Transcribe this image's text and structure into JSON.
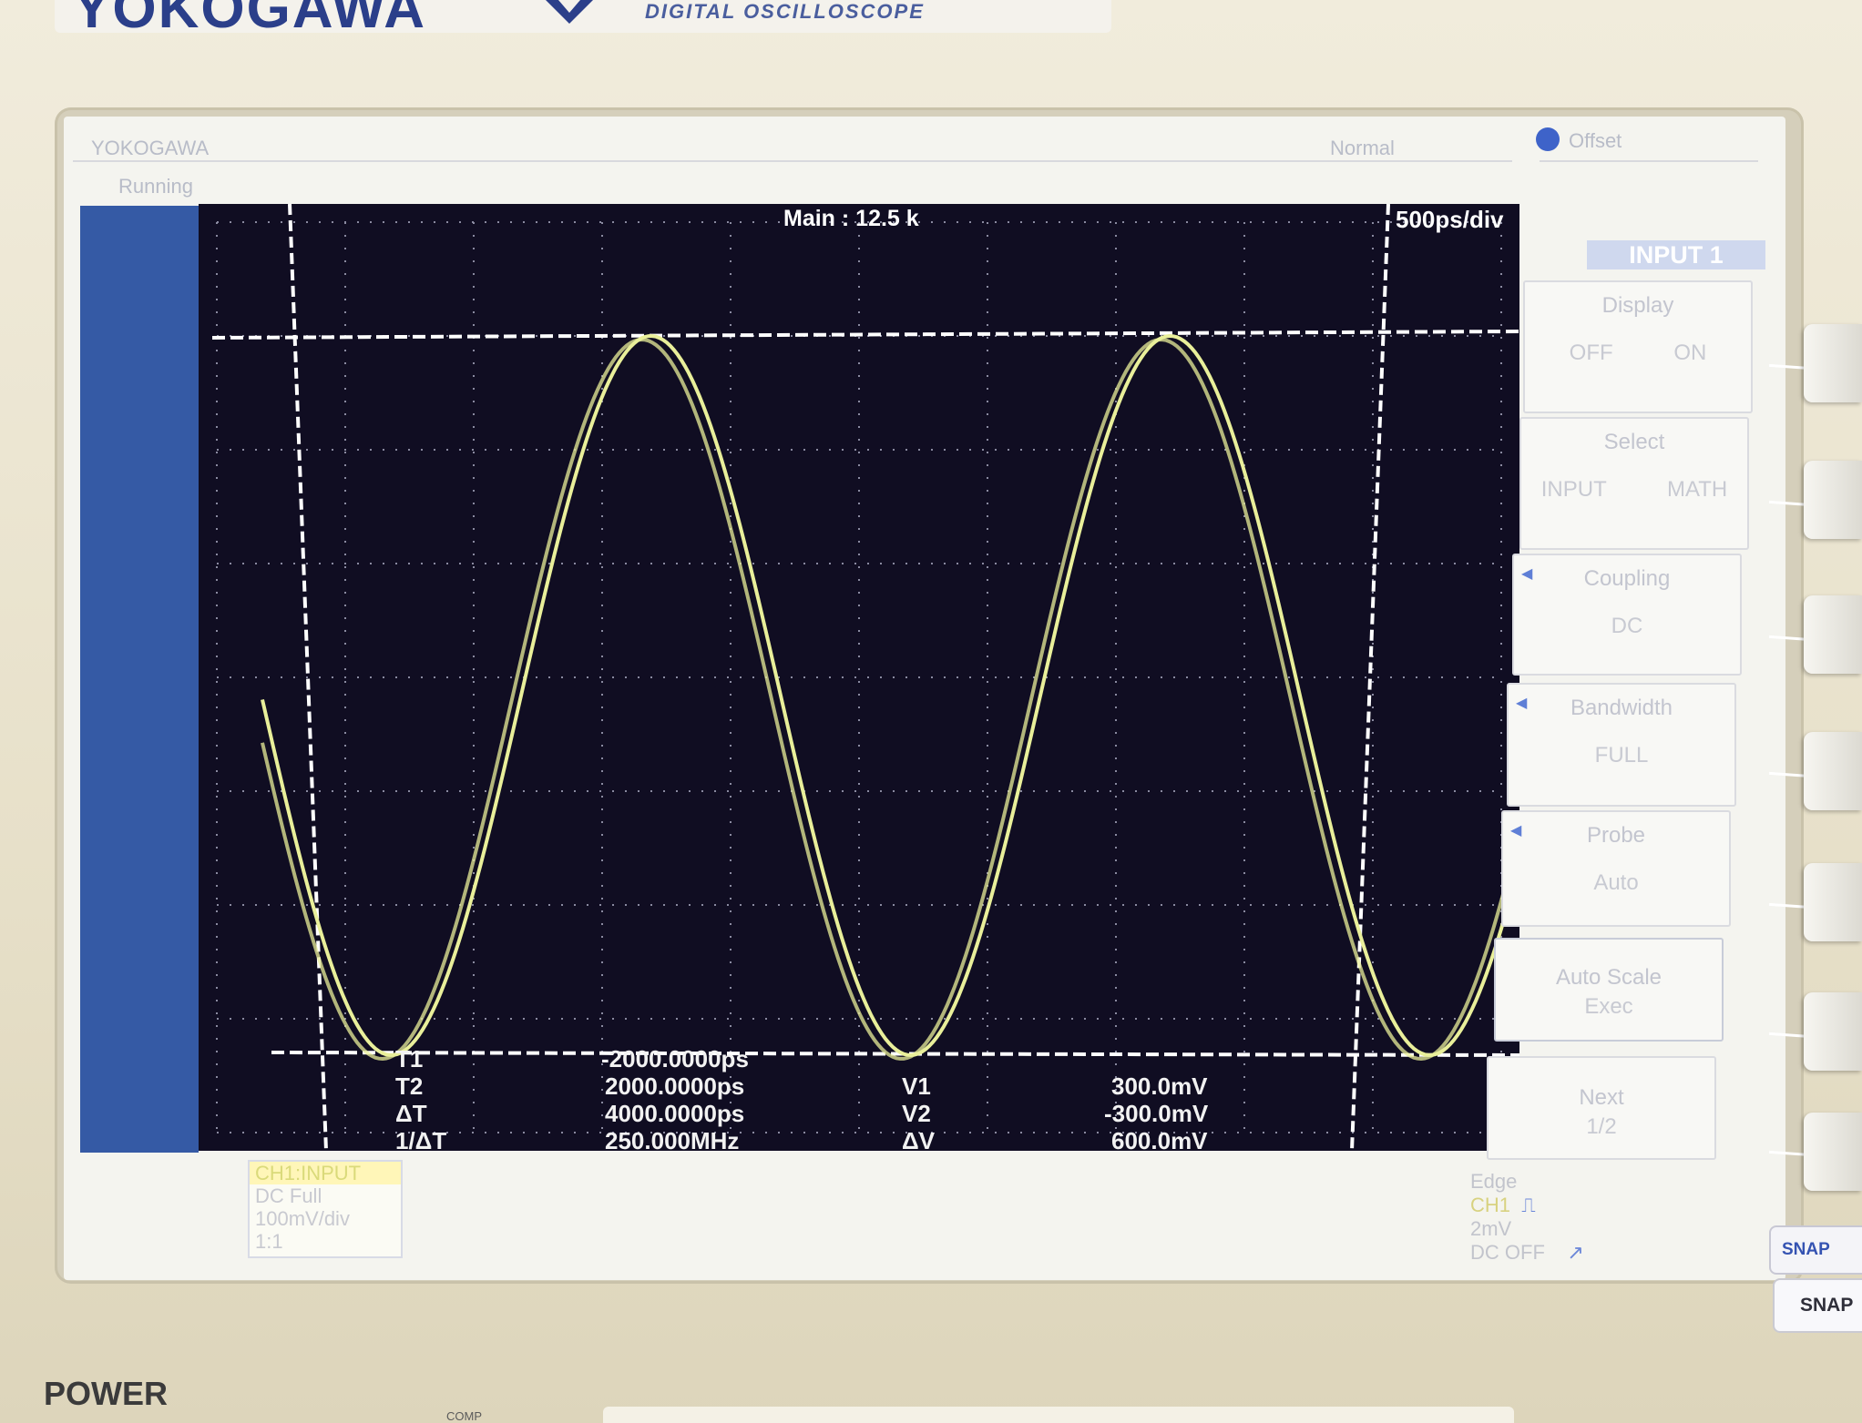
{
  "instrument": {
    "brand": "YOKOGAWA",
    "model_line": "DIGITAL OSCILLOSCOPE"
  },
  "header": {
    "left_brand": "YOKOGAWA",
    "left_sub": "Running",
    "acq_mode": "Normal",
    "offset_label": "Offset"
  },
  "display": {
    "record_label": "Main : 12.5 k",
    "time_div": "500ps/div"
  },
  "cursors": {
    "t1_label": "T1",
    "t1_value": "-2000.0000ps",
    "t2_label": "T2",
    "t2_value": "2000.0000ps",
    "dt_label": "ΔT",
    "dt_value": "4000.0000ps",
    "inv_dt_label": "1/ΔT",
    "inv_dt_value": "250.000MHz",
    "v1_label": "V1",
    "v1_value": "300.0mV",
    "v2_label": "V2",
    "v2_value": "-300.0mV",
    "dv_label": "ΔV",
    "dv_value": "600.0mV"
  },
  "menu": {
    "title": "INPUT 1",
    "items": [
      {
        "title": "Display",
        "value": "OFF ON"
      },
      {
        "title": "Select",
        "value": "INPUT MATH"
      },
      {
        "title": "Coupling",
        "value": "DC"
      },
      {
        "title": "Bandwidth",
        "value": "FULL"
      },
      {
        "title": "Probe",
        "value": "Auto"
      },
      {
        "title": "Auto Scale",
        "value": "Exec"
      },
      {
        "title": "Next",
        "value": "1/2"
      }
    ]
  },
  "channel_status": {
    "line1": "CH1:INPUT",
    "line2": "DC Full",
    "line3": "100mV/div",
    "line4": "1:1"
  },
  "trigger": {
    "type": "Edge",
    "source": "CH1",
    "level": "2mV",
    "filter": "DC OFF"
  },
  "hardware": {
    "snap_clear": "SNAP CLEAR",
    "snap": "SNAP",
    "power": "POWER"
  },
  "colors": {
    "trace": "#e9ef9a",
    "grid_bg": "#100d22",
    "side_panel": "#355aa5",
    "brand_blue": "#2b3f8a"
  }
}
